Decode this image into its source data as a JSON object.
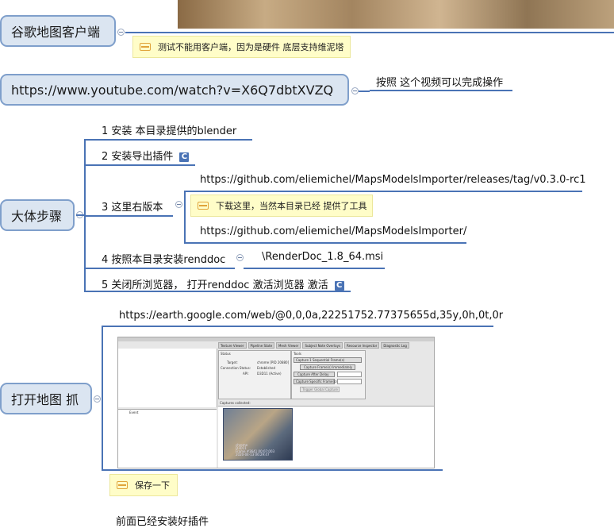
{
  "colors": {
    "accent": "#4a73b5",
    "topic_fill": "#dbe5f1",
    "note_fill": "#fffdc8"
  },
  "nodes": {
    "client": {
      "title": "谷歌地图客户端",
      "note": "测试不能用客户端，因为是硬件 底层支持维泥塔"
    },
    "youtube": {
      "title": "https://www.youtube.com/watch?v=X6Q7dbtXVZQ",
      "child": "按照 这个视频可以完成操作"
    },
    "steps": {
      "title": "大体步骤",
      "items": [
        {
          "label": "1 安装 本目录提供的blender"
        },
        {
          "label": "2 安装导出插件",
          "icon": "C"
        },
        {
          "label": "3 这里右版本",
          "children": [
            "https://github.com/eliemichel/MapsModelsImporter/releases/tag/v0.3.0-rc1",
            "https://github.com/eliemichel/MapsModelsImporter/"
          ],
          "note": "下载这里，当然本目录已经 提供了工具"
        },
        {
          "label": "4 按照本目录安装renddoc",
          "child": "\\RenderDoc_1.8_64.msi"
        },
        {
          "label": "5  关闭所浏览器，  打开renddoc  激活浏览器 激活",
          "icon": "C"
        }
      ]
    },
    "capture": {
      "title": "打开地图 抓",
      "url": "https://earth.google.com/web/@0,0,0a,22251752.77375655d,35y,0h,0t,0r",
      "note": "保存一下"
    },
    "footer": "前面已经安装好插件"
  },
  "screenshot": {
    "tabs": [
      "Texture Viewer",
      "Pipeline State",
      "Mesh Viewer",
      "Subject Note Overlays",
      "Resource Inspector",
      "Diagnostic Log"
    ],
    "status_label": "Status",
    "target_label": "Target:",
    "target_value": "chrome [PID 20880]",
    "conn_label": "Connection Status:",
    "conn_value": "Established",
    "api_label": "API:",
    "api_value": "D3D11 (Active)",
    "tools_label": "Tools",
    "buttons": [
      "Capture 1 Sequential Frame(s)",
      "Capture Frame(s) Immediately",
      "Capture After Delay",
      "Capture Specific Frame(s)",
      "Trigger Global Capture"
    ],
    "captures_label": "Captures collected:",
    "thumb_caption": "chrome\nD3D11\nFrame #3641 00:07:003\n2020-04-13 06:29:47",
    "list_header": "Event"
  }
}
